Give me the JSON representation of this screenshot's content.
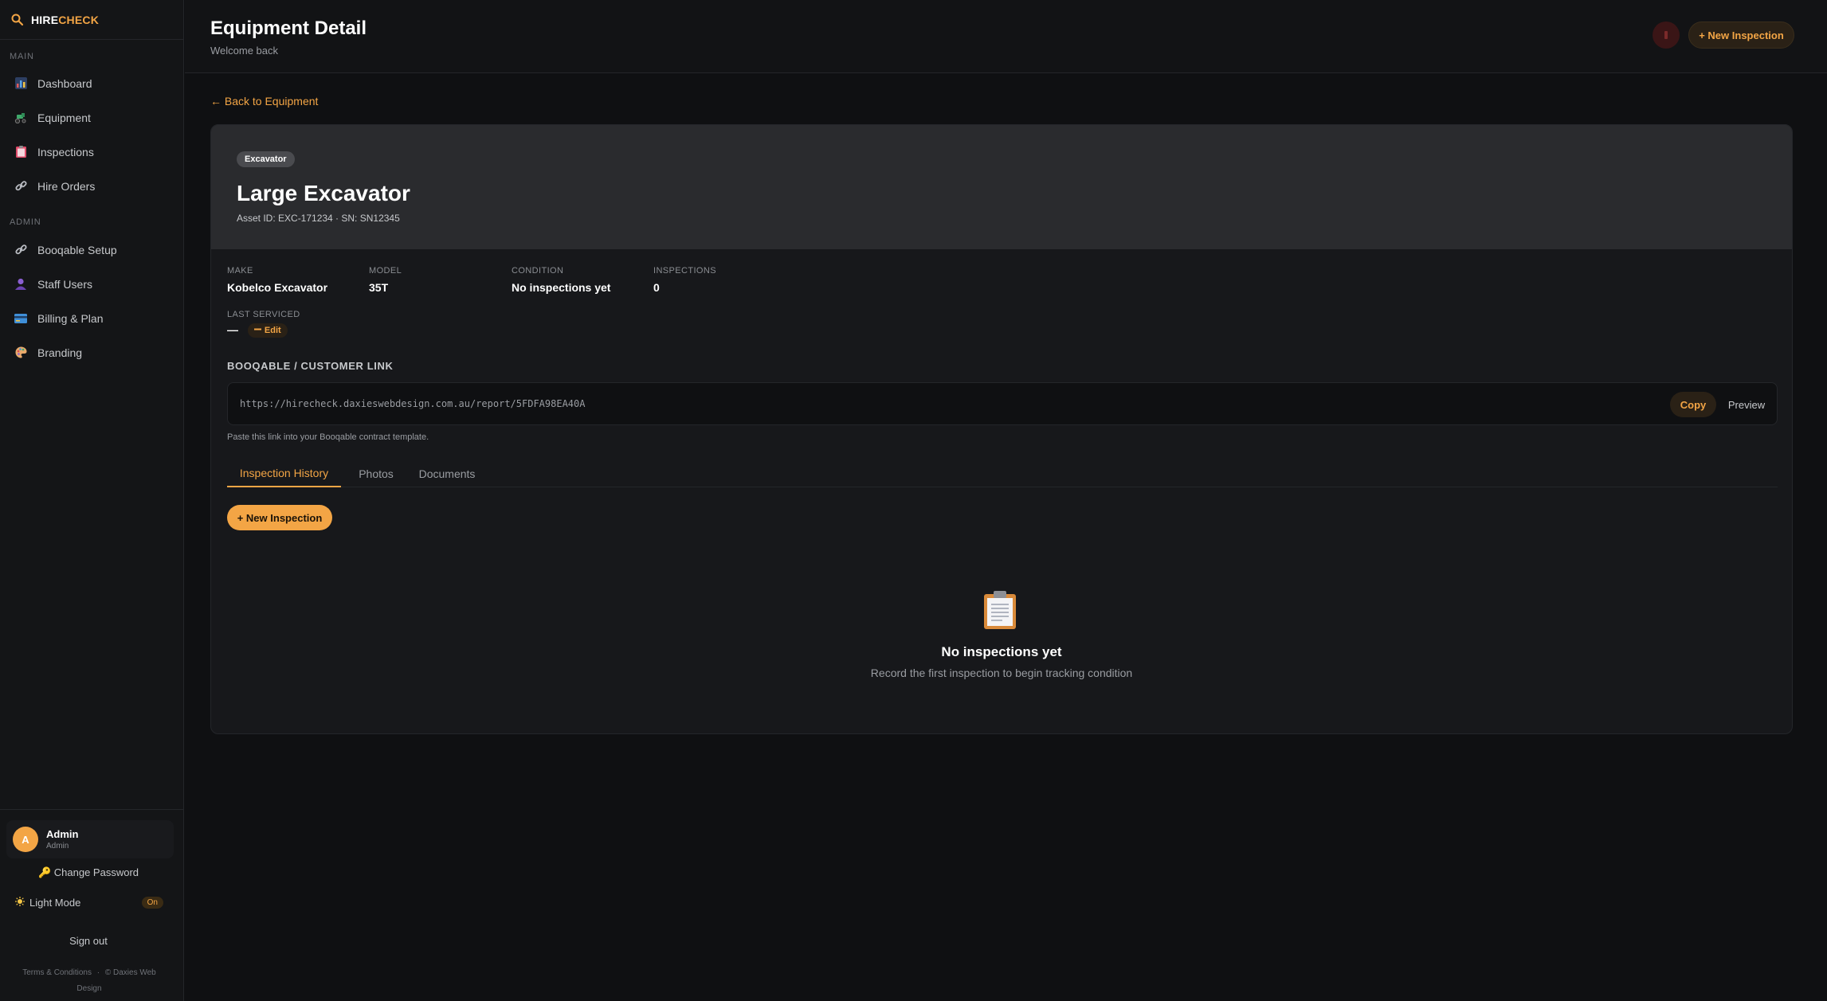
{
  "brand": {
    "hire": "HIRE",
    "check": "CHECK",
    "accent": "#f3a545"
  },
  "sidebar": {
    "main_label": "MAIN",
    "main_items": [
      {
        "label": "Dashboard",
        "icon": "bar-chart-icon"
      },
      {
        "label": "Equipment",
        "icon": "tractor-icon"
      },
      {
        "label": "Inspections",
        "icon": "clipboard-icon"
      },
      {
        "label": "Hire Orders",
        "icon": "link-icon"
      }
    ],
    "admin_label": "ADMIN",
    "admin_items": [
      {
        "label": "Booqable Setup",
        "icon": "link-icon"
      },
      {
        "label": "Staff Users",
        "icon": "user-icon"
      },
      {
        "label": "Billing & Plan",
        "icon": "credit-card-icon"
      },
      {
        "label": "Branding",
        "icon": "palette-icon"
      }
    ],
    "user": {
      "initial": "A",
      "name": "Admin",
      "role": "Admin"
    },
    "change_password": "Change Password",
    "light_mode": "Light Mode",
    "light_mode_state": "On",
    "sign_out": "Sign out",
    "terms": "Terms & Conditions",
    "separator": "·",
    "copyright": "© Daxies Web Design"
  },
  "header": {
    "title": "Equipment Detail",
    "subtitle": "Welcome back",
    "new_inspection": "+ New Inspection"
  },
  "back_link": "← Back to Equipment",
  "equipment": {
    "badge": "Excavator",
    "title": "Large Excavator",
    "asset": "Asset ID: EXC-171234 · SN: SN12345",
    "fields": {
      "make_label": "MAKE",
      "make": "Kobelco Excavator",
      "model_label": "MODEL",
      "model": "35T",
      "condition_label": "CONDITION",
      "condition": "No inspections yet",
      "inspections_label": "INSPECTIONS",
      "inspections": "0",
      "last_serviced_label": "LAST SERVICED",
      "last_serviced": "—",
      "edit": "Edit"
    }
  },
  "link": {
    "label": "BOOQABLE / CUSTOMER LINK",
    "url": "https://hirecheck.daxieswebdesign.com.au/report/5FDFA98EA40A",
    "copy": "Copy",
    "preview": "Preview",
    "help": "Paste this link into your Booqable contract template."
  },
  "tabs": [
    "Inspection History",
    "Photos",
    "Documents"
  ],
  "inspections": {
    "new_button": "+ New Inspection",
    "empty_title": "No inspections yet",
    "empty_sub": "Record the first inspection to begin tracking condition"
  }
}
